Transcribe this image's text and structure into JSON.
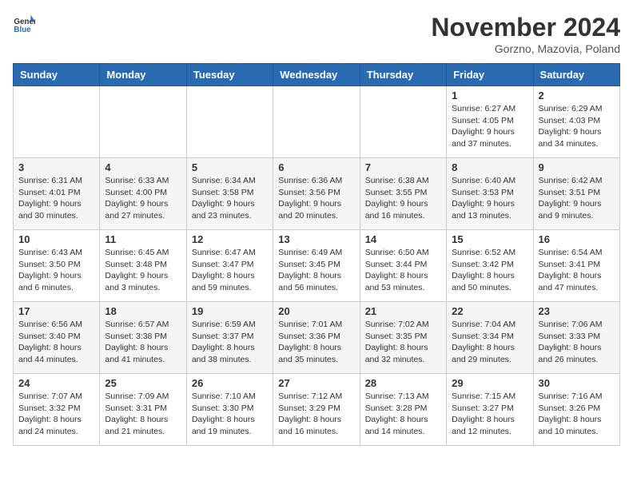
{
  "header": {
    "logo_general": "General",
    "logo_blue": "Blue",
    "month_title": "November 2024",
    "location": "Gorzno, Mazovia, Poland"
  },
  "calendar": {
    "days_of_week": [
      "Sunday",
      "Monday",
      "Tuesday",
      "Wednesday",
      "Thursday",
      "Friday",
      "Saturday"
    ],
    "weeks": [
      [
        {
          "day": "",
          "info": ""
        },
        {
          "day": "",
          "info": ""
        },
        {
          "day": "",
          "info": ""
        },
        {
          "day": "",
          "info": ""
        },
        {
          "day": "",
          "info": ""
        },
        {
          "day": "1",
          "info": "Sunrise: 6:27 AM\nSunset: 4:05 PM\nDaylight: 9 hours and 37 minutes."
        },
        {
          "day": "2",
          "info": "Sunrise: 6:29 AM\nSunset: 4:03 PM\nDaylight: 9 hours and 34 minutes."
        }
      ],
      [
        {
          "day": "3",
          "info": "Sunrise: 6:31 AM\nSunset: 4:01 PM\nDaylight: 9 hours and 30 minutes."
        },
        {
          "day": "4",
          "info": "Sunrise: 6:33 AM\nSunset: 4:00 PM\nDaylight: 9 hours and 27 minutes."
        },
        {
          "day": "5",
          "info": "Sunrise: 6:34 AM\nSunset: 3:58 PM\nDaylight: 9 hours and 23 minutes."
        },
        {
          "day": "6",
          "info": "Sunrise: 6:36 AM\nSunset: 3:56 PM\nDaylight: 9 hours and 20 minutes."
        },
        {
          "day": "7",
          "info": "Sunrise: 6:38 AM\nSunset: 3:55 PM\nDaylight: 9 hours and 16 minutes."
        },
        {
          "day": "8",
          "info": "Sunrise: 6:40 AM\nSunset: 3:53 PM\nDaylight: 9 hours and 13 minutes."
        },
        {
          "day": "9",
          "info": "Sunrise: 6:42 AM\nSunset: 3:51 PM\nDaylight: 9 hours and 9 minutes."
        }
      ],
      [
        {
          "day": "10",
          "info": "Sunrise: 6:43 AM\nSunset: 3:50 PM\nDaylight: 9 hours and 6 minutes."
        },
        {
          "day": "11",
          "info": "Sunrise: 6:45 AM\nSunset: 3:48 PM\nDaylight: 9 hours and 3 minutes."
        },
        {
          "day": "12",
          "info": "Sunrise: 6:47 AM\nSunset: 3:47 PM\nDaylight: 8 hours and 59 minutes."
        },
        {
          "day": "13",
          "info": "Sunrise: 6:49 AM\nSunset: 3:45 PM\nDaylight: 8 hours and 56 minutes."
        },
        {
          "day": "14",
          "info": "Sunrise: 6:50 AM\nSunset: 3:44 PM\nDaylight: 8 hours and 53 minutes."
        },
        {
          "day": "15",
          "info": "Sunrise: 6:52 AM\nSunset: 3:42 PM\nDaylight: 8 hours and 50 minutes."
        },
        {
          "day": "16",
          "info": "Sunrise: 6:54 AM\nSunset: 3:41 PM\nDaylight: 8 hours and 47 minutes."
        }
      ],
      [
        {
          "day": "17",
          "info": "Sunrise: 6:56 AM\nSunset: 3:40 PM\nDaylight: 8 hours and 44 minutes."
        },
        {
          "day": "18",
          "info": "Sunrise: 6:57 AM\nSunset: 3:38 PM\nDaylight: 8 hours and 41 minutes."
        },
        {
          "day": "19",
          "info": "Sunrise: 6:59 AM\nSunset: 3:37 PM\nDaylight: 8 hours and 38 minutes."
        },
        {
          "day": "20",
          "info": "Sunrise: 7:01 AM\nSunset: 3:36 PM\nDaylight: 8 hours and 35 minutes."
        },
        {
          "day": "21",
          "info": "Sunrise: 7:02 AM\nSunset: 3:35 PM\nDaylight: 8 hours and 32 minutes."
        },
        {
          "day": "22",
          "info": "Sunrise: 7:04 AM\nSunset: 3:34 PM\nDaylight: 8 hours and 29 minutes."
        },
        {
          "day": "23",
          "info": "Sunrise: 7:06 AM\nSunset: 3:33 PM\nDaylight: 8 hours and 26 minutes."
        }
      ],
      [
        {
          "day": "24",
          "info": "Sunrise: 7:07 AM\nSunset: 3:32 PM\nDaylight: 8 hours and 24 minutes."
        },
        {
          "day": "25",
          "info": "Sunrise: 7:09 AM\nSunset: 3:31 PM\nDaylight: 8 hours and 21 minutes."
        },
        {
          "day": "26",
          "info": "Sunrise: 7:10 AM\nSunset: 3:30 PM\nDaylight: 8 hours and 19 minutes."
        },
        {
          "day": "27",
          "info": "Sunrise: 7:12 AM\nSunset: 3:29 PM\nDaylight: 8 hours and 16 minutes."
        },
        {
          "day": "28",
          "info": "Sunrise: 7:13 AM\nSunset: 3:28 PM\nDaylight: 8 hours and 14 minutes."
        },
        {
          "day": "29",
          "info": "Sunrise: 7:15 AM\nSunset: 3:27 PM\nDaylight: 8 hours and 12 minutes."
        },
        {
          "day": "30",
          "info": "Sunrise: 7:16 AM\nSunset: 3:26 PM\nDaylight: 8 hours and 10 minutes."
        }
      ]
    ]
  }
}
